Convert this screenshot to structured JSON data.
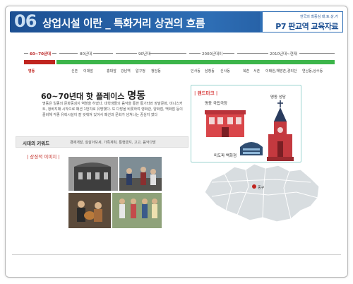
{
  "header": {
    "number": "06",
    "title": "상업시설 이란 _ 특화거리 상권의 흐름",
    "subtitle": "한국의 최중심 대.토.상.가",
    "right_title": "P7 판교역 교육자료"
  },
  "timeline": {
    "eras": [
      "60~70년대",
      "80년대",
      "90년대",
      "2000년대이",
      "2010년대~현재"
    ],
    "places": [
      "명동",
      "신촌",
      "이대앞",
      "홍대앞",
      "강남역",
      "압구정",
      "청담동",
      "인사동",
      "삼청동",
      "신사동",
      "북촌",
      "서촌",
      "이태원,해방촌,경리단",
      "연남동,상수동"
    ]
  },
  "section": {
    "era_prefix": "60~70년대 핫 플레이스",
    "place_name": "명동",
    "description": "명동은 일종의 문화중심지 역할을 하였다. 대학생들의 음악을 통한 통기타와 장발문화, 미니스커트, 청바지패 시작으로 패션 1번지로 유명했다. 또 다방을 비롯하여 영화관, 양화점, 백화점 등이 즐비해 각종 유락시설이 잘 갖춰져 있어서 패션과 문화가 넘쳐나는 중심지 였다",
    "keyword_label": "시대의 키워드",
    "keywords": "경제개발, 잘살아보세, 가족계획, 통행금지, 고고, 음악다방",
    "image_label": "상징적 이미지"
  },
  "landmark": {
    "title": "랜드마크",
    "theater": "명동 국립극장",
    "cathedral": "명동 성당",
    "department_store": "미도파 백화점"
  },
  "map": {
    "district_label": "중구"
  },
  "colors": {
    "header_blue": "#1c4f92",
    "accent_red": "#c0241e",
    "timeline_green": "#3cb54a"
  }
}
